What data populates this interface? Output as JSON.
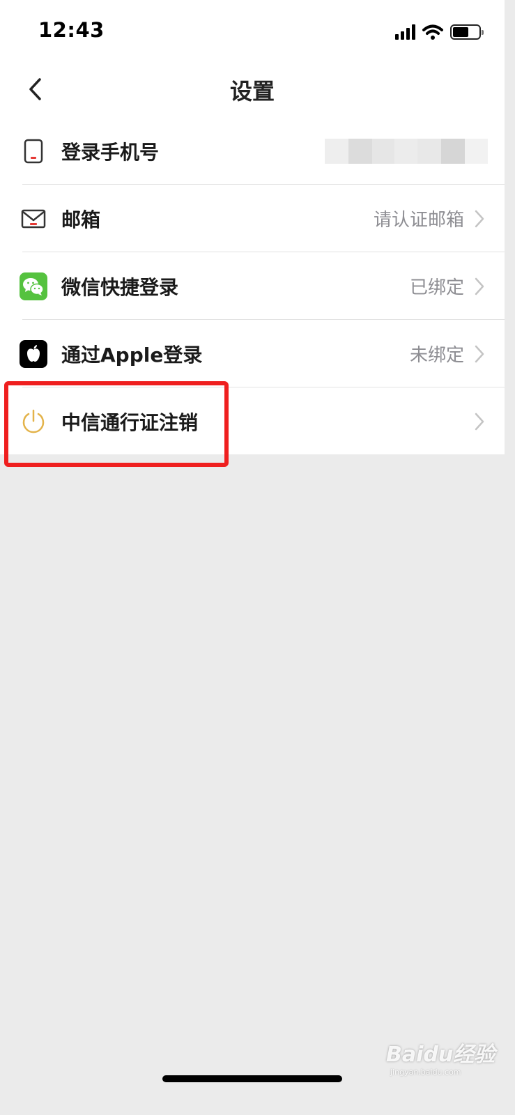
{
  "status_bar": {
    "time": "12:43"
  },
  "header": {
    "title": "设置"
  },
  "settings_list": [
    {
      "label": "登录手机号",
      "value": "",
      "icon": "phone-icon"
    },
    {
      "label": "邮箱",
      "value": "请认证邮箱",
      "icon": "mail-icon"
    },
    {
      "label": "微信快捷登录",
      "value": "已绑定",
      "icon": "wechat-icon"
    },
    {
      "label": "通过Apple登录",
      "value": "未绑定",
      "icon": "apple-icon"
    },
    {
      "label": "中信通行证注销",
      "value": "",
      "icon": "power-icon"
    }
  ],
  "colors": {
    "highlight": "#ef1f1f",
    "wechat_green": "#55c23f",
    "power_gold": "#e3b34a",
    "accent_red": "#e53935"
  },
  "watermark": {
    "main": "Baidu经验",
    "sub": "jingyan.baidu.com"
  }
}
